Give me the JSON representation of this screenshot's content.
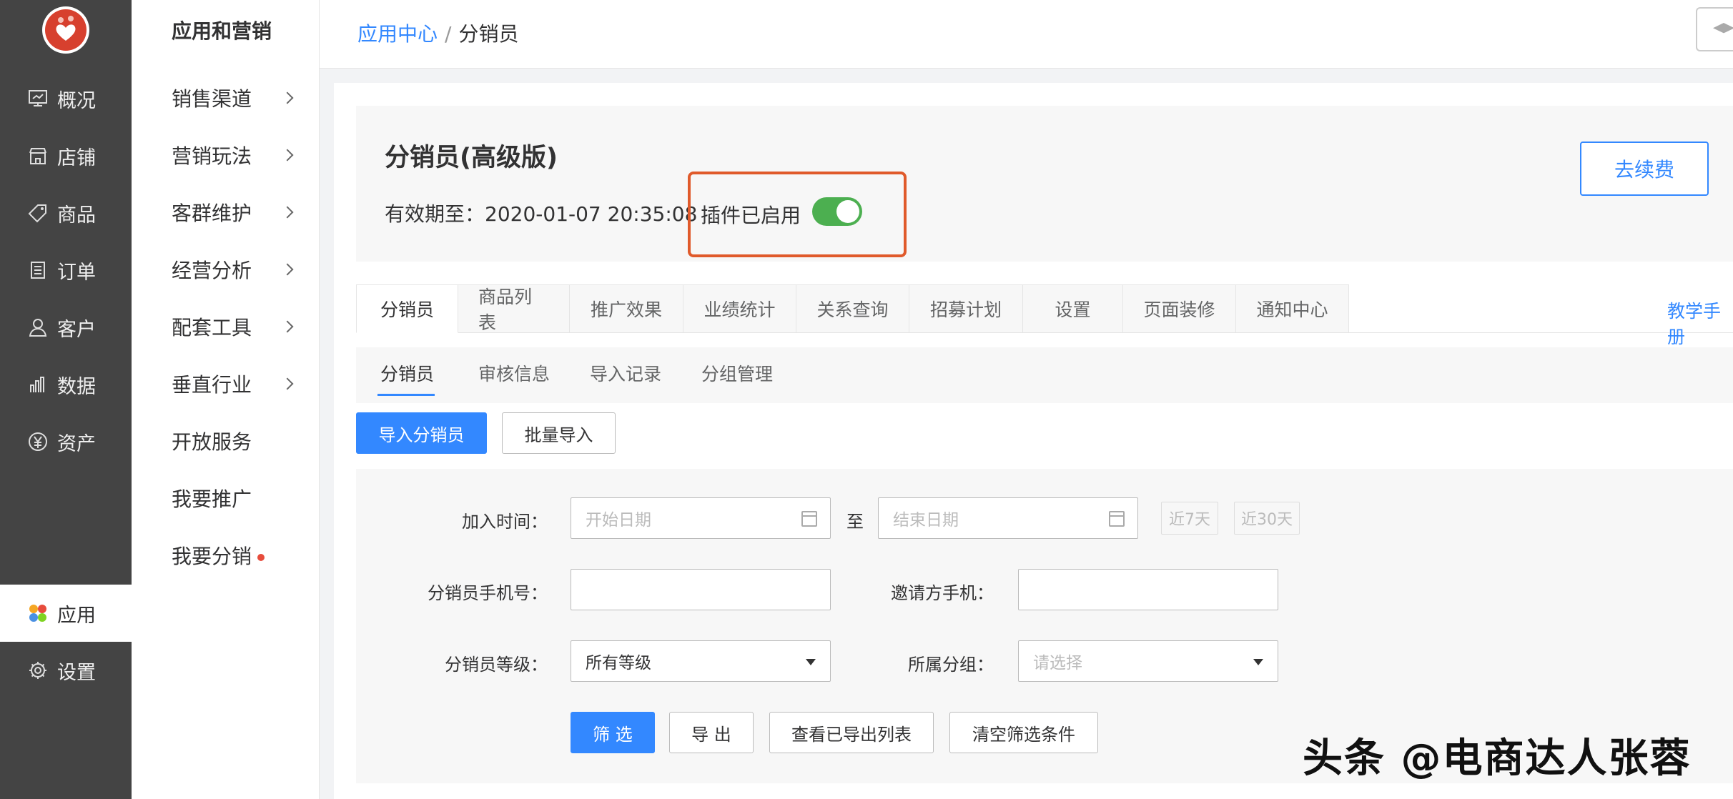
{
  "nav1": {
    "items": [
      {
        "label": "概况",
        "icon": "monitor-icon"
      },
      {
        "label": "店铺",
        "icon": "store-icon"
      },
      {
        "label": "商品",
        "icon": "tag-icon"
      },
      {
        "label": "订单",
        "icon": "document-icon"
      },
      {
        "label": "客户",
        "icon": "user-icon"
      },
      {
        "label": "数据",
        "icon": "bar-chart-icon"
      },
      {
        "label": "资产",
        "icon": "yen-icon"
      },
      {
        "label": "应用",
        "icon": "apps-icon",
        "active": true
      },
      {
        "label": "设置",
        "icon": "gear-icon"
      }
    ]
  },
  "nav2": {
    "title": "应用和营销",
    "items": [
      {
        "label": "销售渠道"
      },
      {
        "label": "营销玩法"
      },
      {
        "label": "客群维护"
      },
      {
        "label": "经营分析"
      },
      {
        "label": "配套工具"
      },
      {
        "label": "垂直行业"
      },
      {
        "label": "开放服务"
      },
      {
        "label": "我要推广"
      },
      {
        "label": "我要分销"
      }
    ]
  },
  "header": {
    "breadcrumb_root": "应用中心",
    "breadcrumb_sep": "/",
    "breadcrumb_current": "分销员"
  },
  "info": {
    "title": "分销员(高级版)",
    "valid_label": "有效期至：",
    "valid_value": "2020-01-07 20:35:08",
    "plugin_status": "插件已启用",
    "plugin_enabled": true,
    "renew_button": "去续费"
  },
  "tabs": [
    "分销员",
    "商品列表",
    "推广效果",
    "业绩统计",
    "关系查询",
    "招募计划",
    "设置",
    "页面装修",
    "通知中心"
  ],
  "help_link": "教学手册",
  "subtabs": [
    "分销员",
    "审核信息",
    "导入记录",
    "分组管理"
  ],
  "actions": {
    "import_button": "导入分销员",
    "batch_import_button": "批量导入"
  },
  "filter": {
    "join_time_label": "加入时间：",
    "start_placeholder": "开始日期",
    "to_label": "至",
    "end_placeholder": "结束日期",
    "last7": "近7天",
    "last30": "近30天",
    "phone_label": "分销员手机号：",
    "inviter_label": "邀请方手机：",
    "level_label": "分销员等级：",
    "level_value": "所有等级",
    "group_label": "所属分组：",
    "group_placeholder": "请选择",
    "filter_button": "筛 选",
    "export_button": "导 出",
    "view_export_button": "查看已导出列表",
    "clear_button": "清空筛选条件"
  },
  "watermark": "头条 @电商达人张蓉",
  "colors": {
    "accent": "#3388ff",
    "sidebar": "#444444",
    "highlight_border": "#e05a2b",
    "toggle_on": "#4caf50"
  }
}
